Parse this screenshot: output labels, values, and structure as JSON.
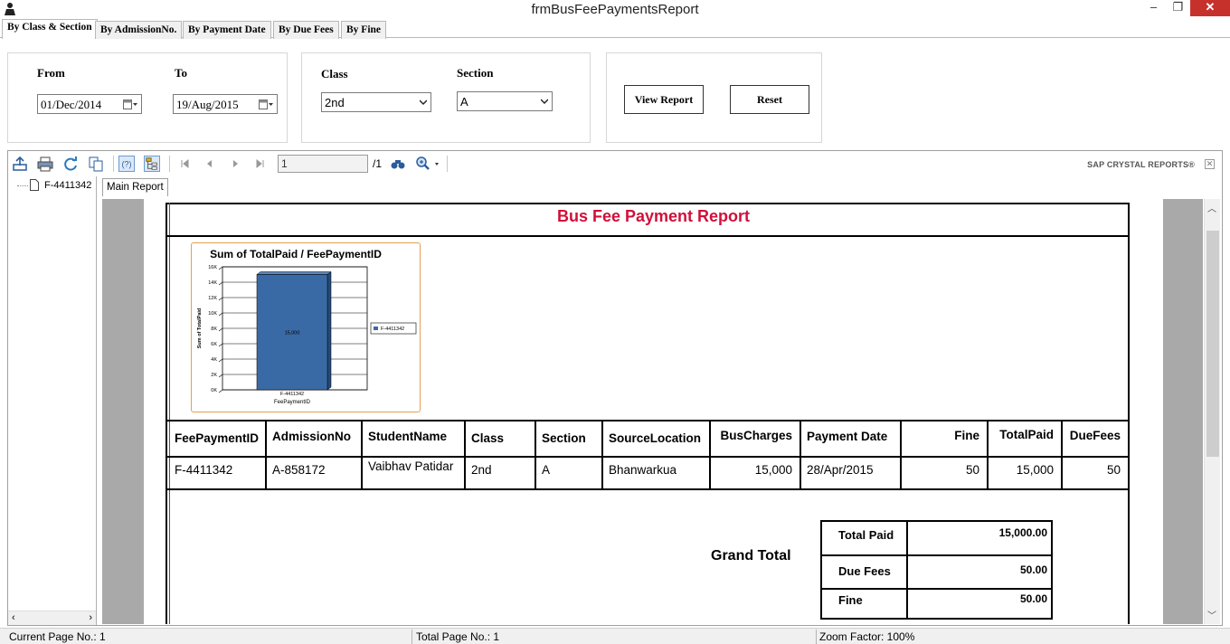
{
  "window": {
    "title": "frmBusFeePaymentsReport"
  },
  "tabs": [
    {
      "label": "By Class & Section",
      "active": true
    },
    {
      "label": "By AdmissionNo.",
      "active": false
    },
    {
      "label": "By Payment Date",
      "active": false
    },
    {
      "label": "By Due Fees",
      "active": false
    },
    {
      "label": "By Fine",
      "active": false
    }
  ],
  "filters": {
    "from_label": "From",
    "from_value": "01/Dec/2014",
    "to_label": "To",
    "to_value": "19/Aug/2015",
    "class_label": "Class",
    "class_value": "2nd",
    "section_label": "Section",
    "section_value": "A",
    "view_button": "View Report",
    "reset_button": "Reset"
  },
  "viewer": {
    "page_value": "1",
    "page_total": "/1",
    "brand": "SAP CRYSTAL REPORTS®",
    "tree_item": "F-4411342",
    "report_tab": "Main Report"
  },
  "report": {
    "title": "Bus Fee Payment Report",
    "title_color": "#d0103a",
    "columns": [
      "FeePaymentID",
      "AdmissionNo",
      "StudentName",
      "Class",
      "Section",
      "SourceLocation",
      "BusCharges",
      "Payment Date",
      "Fine",
      "TotalPaid",
      "DueFees"
    ],
    "rows": [
      [
        "F-4411342",
        "A-858172",
        "Vaibhav Patidar",
        "2nd",
        "A",
        "Bhanwarkua",
        "15,000",
        "28/Apr/2015",
        "50",
        "15,000",
        "50"
      ]
    ],
    "grand_total_label": "Grand Total",
    "totals": [
      {
        "label": "Total Paid",
        "value": "15,000.00"
      },
      {
        "label": "Due Fees",
        "value": "50.00"
      },
      {
        "label": "Fine",
        "value": "50.00"
      }
    ]
  },
  "chart_data": {
    "type": "bar",
    "title": "Sum of TotalPaid / FeePaymentID",
    "xlabel": "FeePaymentID",
    "ylabel": "Sum of TotalPaid",
    "categories": [
      "F-4411342"
    ],
    "series": [
      {
        "name": "F-4411342",
        "values": [
          15000
        ]
      }
    ],
    "data_labels": [
      "15,000"
    ],
    "ylim": [
      0,
      16000
    ],
    "yticks": [
      "0K",
      "2K",
      "4K",
      "6K",
      "8K",
      "10K",
      "12K",
      "14K",
      "16K"
    ],
    "legend_position": "right",
    "bar_color": "#3a6aa5",
    "grid": true
  },
  "status": {
    "current_page": "Current Page No.: 1",
    "total_page": "Total Page No.: 1",
    "zoom": "Zoom Factor: 100%"
  }
}
